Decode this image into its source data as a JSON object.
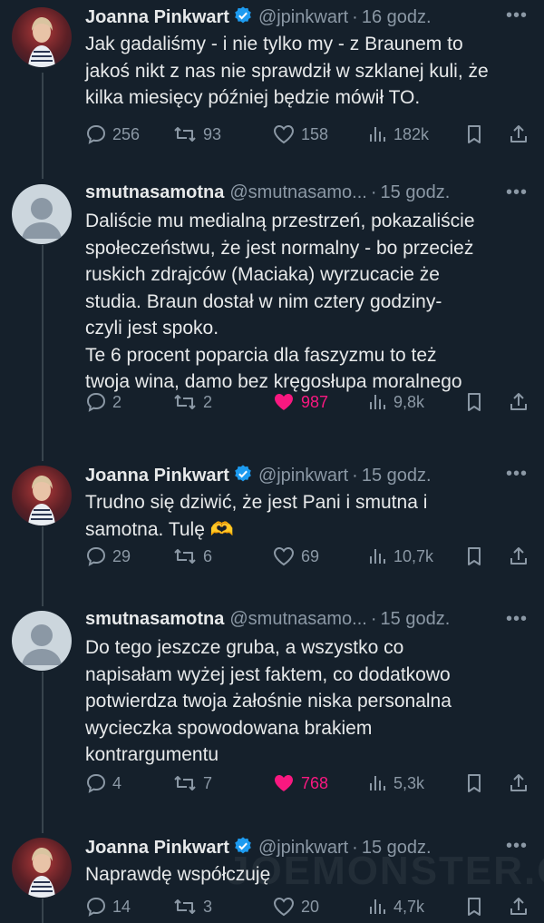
{
  "tweets": [
    {
      "name": "Joanna Pinkwart",
      "verified": true,
      "handle": "@jpinkwart",
      "time": "16 godz.",
      "text": "Jak gadaliśmy - i nie tylko my - z Braunem to\njakoś nikt z nas nie sprawdził w szklanej kuli, że\nkilka miesięcy później będzie mówił TO.",
      "replies": "256",
      "reposts": "93",
      "likes": "158",
      "views": "182k",
      "liked": false
    },
    {
      "name": "smutnasamotna",
      "verified": false,
      "handle": "@smutnasamo...",
      "time": "15 godz.",
      "text": "Daliście mu medialną przestrzeń, pokazaliście\nspołeczeństwu, że jest normalny - bo przecież\nruskich zdrajców (Maciaka) wyrzucacie że\nstudia. Braun dostał w nim cztery godziny-\nczyli jest spoko.\nTe 6 procent poparcia dla faszyzmu to też\ntwoja wina, damo bez kręgosłupa moralnego",
      "replies": "2",
      "reposts": "2",
      "likes": "987",
      "views": "9,8k",
      "liked": true
    },
    {
      "name": "Joanna Pinkwart",
      "verified": true,
      "handle": "@jpinkwart",
      "time": "15 godz.",
      "text": "Trudno się dziwić, że jest Pani i smutna i\nsamotna. Tulę 🫶",
      "replies": "29",
      "reposts": "6",
      "likes": "69",
      "views": "10,7k",
      "liked": false
    },
    {
      "name": "smutnasamotna",
      "verified": false,
      "handle": "@smutnasamo...",
      "time": "15 godz.",
      "text": "Do tego jeszcze gruba, a wszystko co\nnapisałam wyżej jest faktem, co dodatkowo\npotwierdza twoja żałośnie niska personalna\nwycieczka spowodowana brakiem\nkontrargumentu",
      "replies": "4",
      "reposts": "7",
      "likes": "768",
      "views": "5,3k",
      "liked": true
    },
    {
      "name": "Joanna Pinkwart",
      "verified": true,
      "handle": "@jpinkwart",
      "time": "15 godz.",
      "text": "Naprawdę współczuję",
      "replies": "14",
      "reposts": "3",
      "likes": "20",
      "views": "4,7k",
      "liked": false
    }
  ],
  "watermark": "JOEMONSTER.ORG",
  "colors": {
    "background": "#15202b",
    "text": "#e7e9ea",
    "muted": "#8b98a5",
    "like": "#f91880",
    "verified": "#1d9bf0"
  }
}
